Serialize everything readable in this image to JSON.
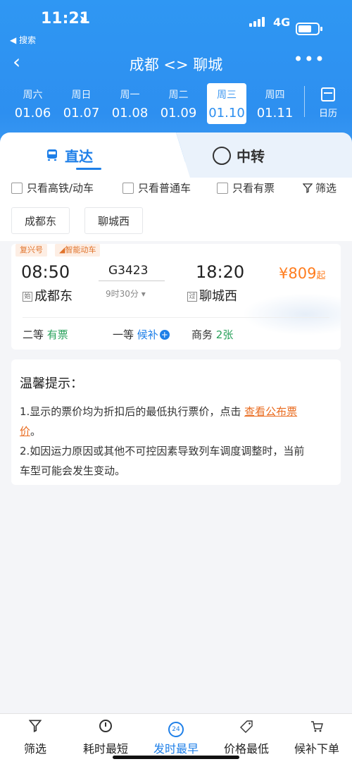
{
  "status_bar": {
    "time": "11:21",
    "back_app": "◀ 搜索",
    "network": "4G"
  },
  "nav": {
    "title": "成都 <> 聊城",
    "more": "•••"
  },
  "dates": [
    {
      "weekday": "周六",
      "date": "01.06"
    },
    {
      "weekday": "周日",
      "date": "01.07"
    },
    {
      "weekday": "周一",
      "date": "01.08"
    },
    {
      "weekday": "周二",
      "date": "01.09"
    },
    {
      "weekday": "周三",
      "date": "01.10",
      "active": true
    },
    {
      "weekday": "周四",
      "date": "01.11"
    }
  ],
  "calendar_label": "日历",
  "tabs": {
    "direct": "直达",
    "transfer": "中转"
  },
  "filters": {
    "high_speed": "只看高铁/动车",
    "normal": "只看普通车",
    "available": "只看有票",
    "filter": "筛选"
  },
  "stations": {
    "from": "成都东",
    "to": "聊城西"
  },
  "train": {
    "tag1": "复兴号",
    "tag2": "智能动车",
    "dep_time": "08:50",
    "arr_time": "18:20",
    "number": "G3423",
    "duration": "9时30分",
    "dep_badge": "始",
    "dep_station": "成都东",
    "arr_badge": "过",
    "arr_station": "聊城西",
    "price": "¥809",
    "price_suffix": "起",
    "seats": [
      {
        "type": "二等",
        "status": "有票"
      },
      {
        "type": "一等",
        "status": "候补"
      },
      {
        "type": "商务",
        "status": "2张"
      }
    ]
  },
  "tips": {
    "title": "温馨提示：",
    "line1_prefix": "1.显示的票价均为折扣后的最低执行票价，点击 ",
    "line1_link_a": "查看公布票",
    "line1_link_b": "价",
    "line1_end": "。",
    "line2a": "2.如因运力原因或其他不可控因素导致列车调度调整时，当前",
    "line2b": "车型可能会发生变动。"
  },
  "bottom_bar": [
    {
      "label": "筛选",
      "icon": "filter-icon"
    },
    {
      "label": "耗时最短",
      "icon": "clock-icon"
    },
    {
      "label": "发时最早",
      "icon": "24h-icon",
      "active": true,
      "icon_text": "24"
    },
    {
      "label": "价格最低",
      "icon": "price-tag-icon"
    },
    {
      "label": "候补下单",
      "icon": "cart-icon"
    }
  ],
  "colors": {
    "primary": "#2d8ff0",
    "price": "#ff7d1f",
    "available": "#2aa25c",
    "link": "#e96b1f"
  }
}
